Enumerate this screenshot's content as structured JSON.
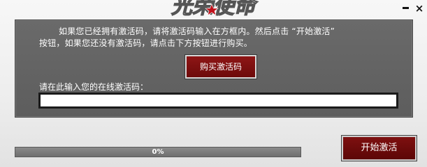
{
  "window": {
    "minimize_symbol": "–",
    "close_symbol": "×",
    "accent_color": "#7e1010"
  },
  "logo": {
    "text": "光荣使命",
    "icon": "red-star-icon"
  },
  "panel": {
    "instruction_line1": "如果您已经拥有激活码，请将激活码输入在方框内。然后点击 “开始激活”",
    "instruction_line2": "按钮，如果您还没有激活码，请点击下方按钮进行购买。",
    "buy_button_label": "购买激活码",
    "input_label": "请在此输入您的在线激活码：",
    "input_value": "",
    "input_placeholder": ""
  },
  "progress": {
    "value": 0,
    "label": "0%"
  },
  "start_button_label": "开始激活"
}
